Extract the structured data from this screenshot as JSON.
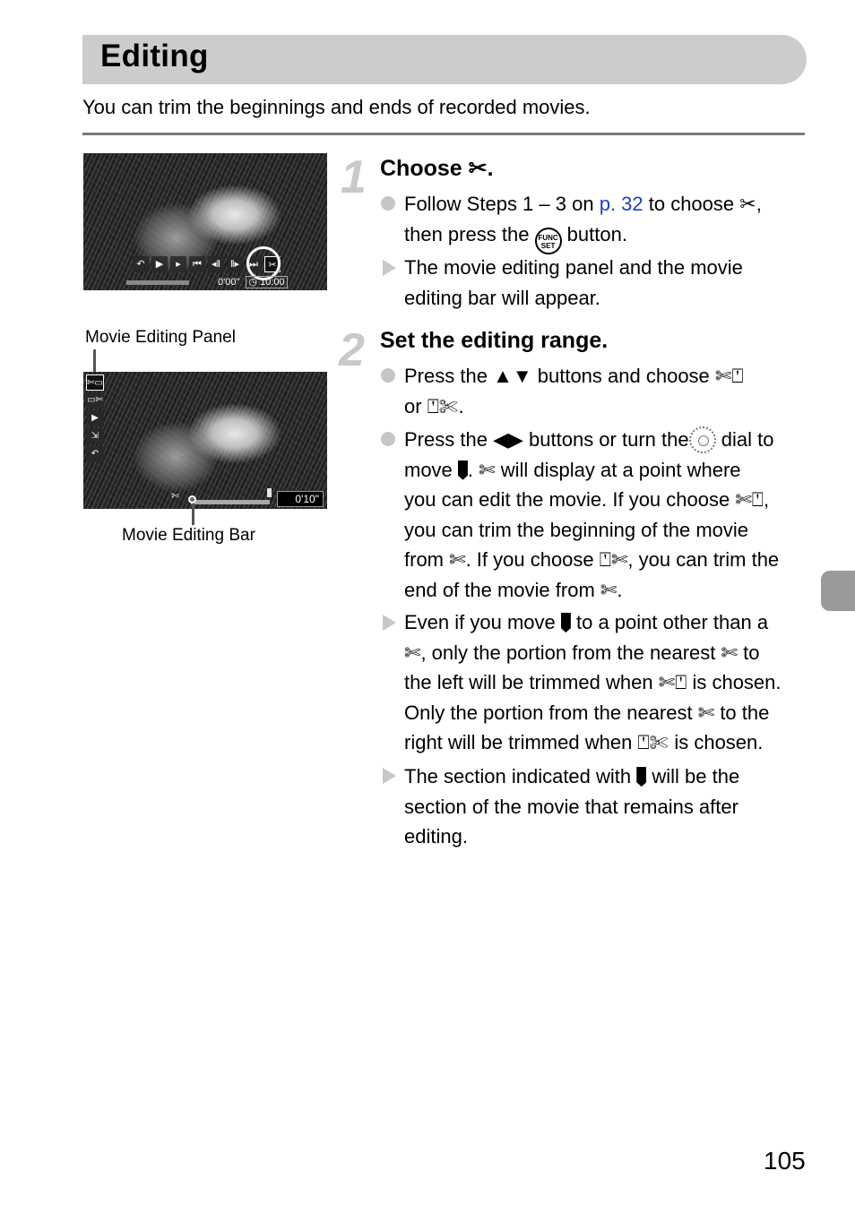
{
  "page": {
    "title": "Editing",
    "intro": "You can trim the beginnings and ends of recorded movies.",
    "page_number": "105"
  },
  "figures": {
    "photo1": {
      "controls": [
        "return-icon",
        "play-icon",
        "slow-play-icon",
        "first-frame-icon",
        "previous-frame-icon",
        "next-frame-icon",
        "last-frame-icon",
        "scissors-icon"
      ],
      "time_elapsed": "0'00\"",
      "time_total": "10:00"
    },
    "photo2": {
      "panel_label": "Movie Editing Panel",
      "bar_label": "Movie Editing Bar",
      "panel_items": [
        "trim-beginning-icon",
        "trim-end-icon",
        "play-icon",
        "save-icon",
        "return-icon"
      ],
      "time": "0'10\""
    }
  },
  "steps": [
    {
      "number": "1",
      "title": "Choose",
      "title_icon": "scissors-icon",
      "items": [
        {
          "type": "action",
          "text_a": "Follow Steps 1 – 3 on ",
          "link": "p. 32",
          "text_b": " to choose ",
          "text_c": ",",
          "text_d": "then press the ",
          "button_icon": "FUNC. SET",
          "text_e": " button."
        },
        {
          "type": "result",
          "text": "The movie editing panel and the movie editing bar will appear."
        }
      ]
    },
    {
      "number": "2",
      "title": "Set the editing range.",
      "items": [
        {
          "type": "action",
          "a": "Press the",
          "b": "buttons and choose",
          "c": "or",
          "d": "."
        },
        {
          "type": "action",
          "a": "Press the",
          "b": "buttons or turn the",
          "c": "dial to",
          "d": "move",
          "e": ".",
          "f": "will display at a point where",
          "g": "you can edit the movie. If you choose",
          "h": ",",
          "i": "you can trim the beginning of the movie",
          "j": "from",
          "k": ". If you choose",
          "l": ", you can trim the",
          "m": "end of the movie from",
          "n": "."
        },
        {
          "type": "result",
          "a": "Even if you move",
          "b": "to a point other than a",
          "c": ", only the portion from the nearest",
          "d": "to",
          "e": "the left will be trimmed when",
          "f": "is chosen.",
          "g": "Only the portion from the nearest",
          "h": "to the",
          "i": "right will be trimmed when",
          "j": "is chosen."
        },
        {
          "type": "result",
          "a": "The section indicated with",
          "b": "will be the",
          "c": "section of the movie that remains after",
          "d": "editing."
        }
      ]
    }
  ],
  "icons": {
    "scissors_open": "✂",
    "scissors_cut": "✄",
    "up_down": "▲▼",
    "left_right": "◀▶"
  }
}
